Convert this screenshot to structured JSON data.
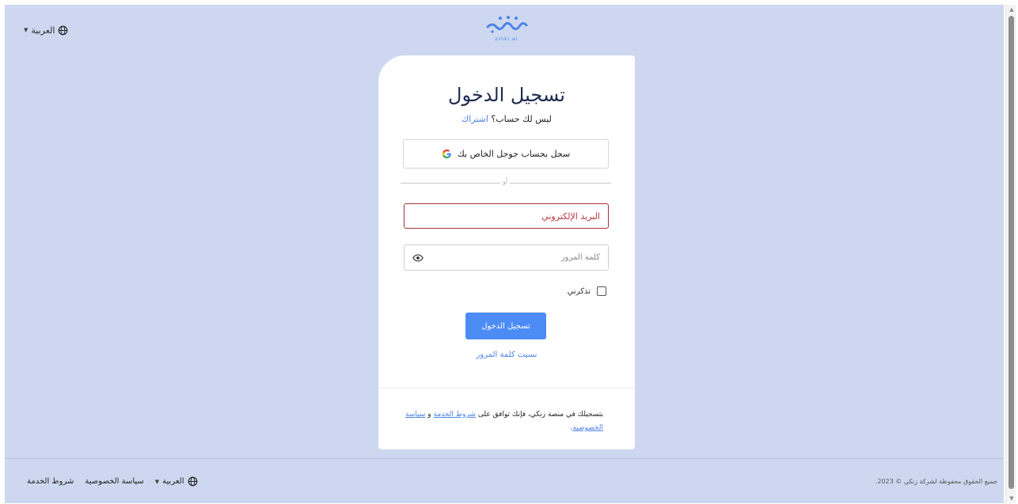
{
  "header": {
    "language": "العربية",
    "logo_text": "zinki.ai"
  },
  "login": {
    "title": "تسجيل الدخول",
    "no_account": "ليس لك حساب؟",
    "signup_link": "اشتراك",
    "google_button": "سجل بحساب جوجل الخاص بك",
    "divider_text": "أو",
    "email_placeholder": "البريد الإلكتروني",
    "password_placeholder": "كلمة المرور",
    "remember_me": "تذكرني",
    "submit_button": "تسجيل الدخول",
    "forgot_password": "نسيت كلمة المرور",
    "terms_prefix": "بتسجيلك في منصة زنكي، فإنك توافق على",
    "terms_link": "شروط الخدمة",
    "terms_and": "و",
    "privacy_link": "سياسة الخصوصية",
    "terms_end": "."
  },
  "footer": {
    "terms": "شروط الخدمة",
    "privacy": "سياسة الخصوصية",
    "language": "العربية",
    "copyright": "جميع الحقوق محفوظة لشركة زنكي © 2023."
  },
  "colors": {
    "background": "#cdd8f0",
    "accent": "#4d8cf5",
    "error": "#a3303a"
  }
}
